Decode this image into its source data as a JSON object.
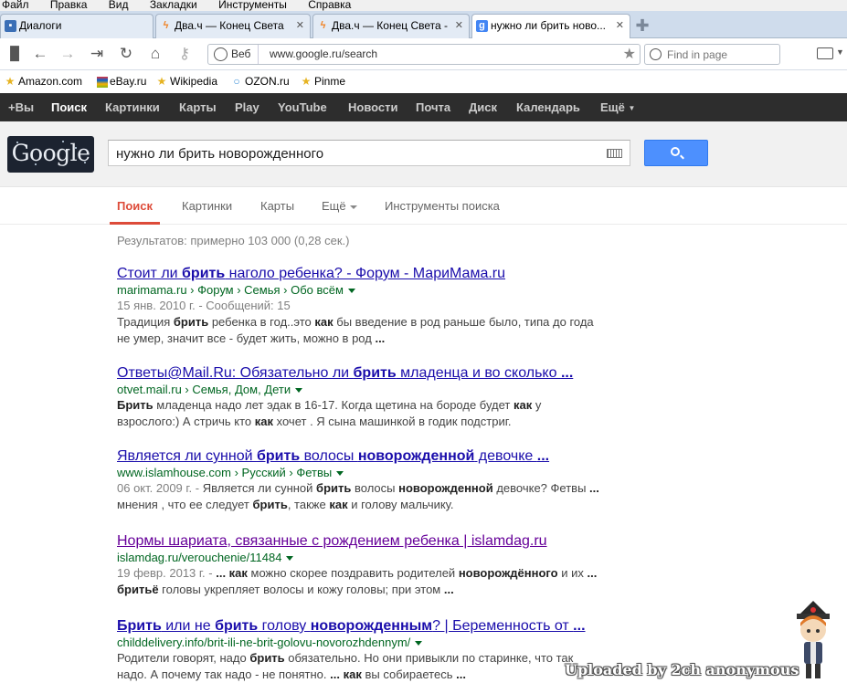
{
  "menubar": {
    "items": [
      "Файл",
      "Правка",
      "Вид",
      "Закладки",
      "Инструменты",
      "Справка"
    ]
  },
  "tabs": [
    {
      "title": "Диалоги",
      "icon": "chat-icon",
      "active": false
    },
    {
      "title": "Два.ч — Конец Света",
      "icon": "lightning-icon",
      "active": false
    },
    {
      "title": "Два.ч — Конец Света -",
      "icon": "lightning-icon",
      "active": false
    },
    {
      "title": "нужно ли брить ново...",
      "icon": "google-icon",
      "active": true
    }
  ],
  "address": {
    "protocol_label": "Веб",
    "url": "www.google.ru/search"
  },
  "find": {
    "placeholder": "Find in page"
  },
  "bookmarks": [
    {
      "label": "Amazon.com",
      "icon": "star-icon"
    },
    {
      "label": "eBay.ru",
      "icon": "ebay-icon"
    },
    {
      "label": "Wikipedia",
      "icon": "star-icon"
    },
    {
      "label": "OZON.ru",
      "icon": "ozon-icon"
    },
    {
      "label": "Pinme",
      "icon": "star-icon"
    }
  ],
  "gbar": {
    "items": [
      "+Вы",
      "Поиск",
      "Картинки",
      "Карты",
      "Play",
      "YouTube",
      "Новости",
      "Почта",
      "Диск",
      "Календарь",
      "Ещё"
    ]
  },
  "logo": {
    "text": "Google"
  },
  "search": {
    "query": "нужно ли брить новорожденного"
  },
  "search_tabs": {
    "items": [
      "Поиск",
      "Картинки",
      "Карты",
      "Ещё",
      "Инструменты поиска"
    ]
  },
  "stats": "Результатов: примерно 103 000 (0,28 сек.)",
  "results": [
    {
      "title": [
        "Стоит ли ",
        "брить",
        " наголо ребенка? - Форум - МариМама.ru"
      ],
      "url": "marimama.ru › Форум › Семья › Обо всём",
      "date": "15 янв. 2010 г. - Сообщений: 15",
      "snippet": [
        "Традиция ",
        "брить",
        " ребенка в год..это ",
        "как",
        " бы введение в род раньше было, типа до года не умер, значит все - будет жить, можно в род ",
        "..."
      ],
      "visited": false
    },
    {
      "title": [
        "Ответы@Mail.Ru: Обязательно ли ",
        "брить",
        " младенца и во сколько ",
        "..."
      ],
      "url": "otvet.mail.ru › Семья, Дом, Дети",
      "date": "",
      "snippet": [
        "Брить",
        " младенца надо лет эдак в 16-17. Когда щетина на бороде будет ",
        "как",
        " у взрослого:) А стричь кто ",
        "как",
        " хочет . Я сына машинкой в годик подстриг."
      ],
      "visited": false
    },
    {
      "title": [
        "Является ли сунной ",
        "брить",
        " волосы ",
        "новорожденной",
        " девочке ",
        "..."
      ],
      "url": "www.islamhouse.com › Русский › Фетвы",
      "date": "06 окт. 2009 г. - ",
      "snippet": [
        "Является ли сунной ",
        "брить",
        " волосы ",
        "новорожденной",
        " девочке? Фетвы ",
        "...",
        " мнения , что ее следует ",
        "брить",
        ", также ",
        "как",
        " и голову мальчику."
      ],
      "visited": false
    },
    {
      "title": [
        "Нормы шариата, связанные с рождением ребенка | islamdag.ru",
        "",
        ""
      ],
      "url": "islamdag.ru/verouchenie/11484",
      "date": "19 февр. 2013 г. - ",
      "snippet": [
        "... ",
        "как",
        " можно скорее поздравить родителей ",
        "новорождённого",
        " и их ",
        "...",
        " ",
        "бритьё",
        " головы укрепляет волосы и кожу головы; при этом ",
        "..."
      ],
      "visited": true
    },
    {
      "title": [
        "Брить",
        " или не ",
        "брить",
        " голову ",
        "новорожденным",
        "? | Беременность от ",
        "..."
      ],
      "url": "childdelivery.info/brit-ili-ne-brit-golovu-novorozhdennym/",
      "date": "",
      "snippet": [
        "Родители говорят, надо ",
        "брить",
        " обязательно. Но они привыкли по старинке, что так надо. А почему так надо - не понятно. ",
        "...",
        " ",
        "как",
        " вы собираетесь ",
        "..."
      ],
      "visited": false
    }
  ],
  "watermark": "Uploaded by 2ch anonymous",
  "colors": {
    "link": "#1a0dab",
    "visited": "#660099",
    "url_green": "#006621",
    "accent_red": "#dd4b39",
    "button_blue": "#4d90fe",
    "gbar_bg": "#2d2d2d"
  }
}
